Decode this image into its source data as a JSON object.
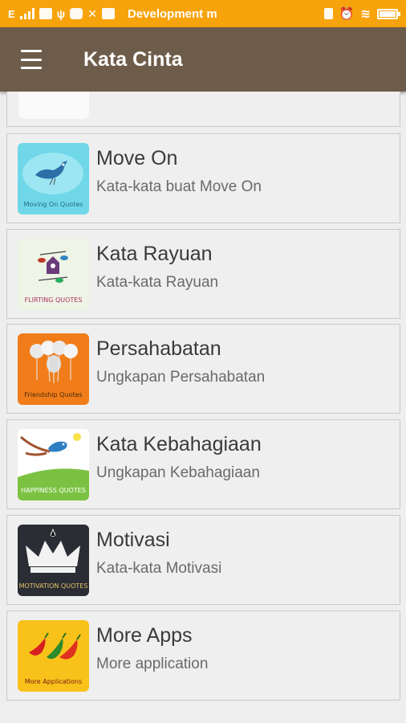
{
  "status_bar": {
    "carrier_text": "Development m",
    "bg_color": "#f7a30b",
    "battery_level": 0.9
  },
  "app_bar": {
    "title": "Kata Cinta",
    "menu_icon": "hamburger-menu-icon",
    "bg_color": "#6e5c4a"
  },
  "items": [
    {
      "title": "Move On",
      "subtitle": "Kata-kata buat Move On",
      "thumb_caption": "Moving On Quotes",
      "thumb_icon": "bird-icon"
    },
    {
      "title": "Kata Rayuan",
      "subtitle": "Kata-kata Rayuan",
      "thumb_caption": "FLIRTING QUOTES",
      "thumb_icon": "birdhouse-icon"
    },
    {
      "title": "Persahabatan",
      "subtitle": "Ungkapan Persahabatan",
      "thumb_caption": "Friendship Quotes",
      "thumb_icon": "balloons-icon"
    },
    {
      "title": "Kata Kebahagiaan",
      "subtitle": "Ungkapan Kebahagiaan",
      "thumb_caption": "HAPPINESS QUOTES",
      "thumb_icon": "bluebird-icon"
    },
    {
      "title": "Motivasi",
      "subtitle": "Kata-kata Motivasi",
      "thumb_caption": "MOTIVATION QUOTES",
      "thumb_icon": "crown-icon"
    },
    {
      "title": "More Apps",
      "subtitle": "More application",
      "thumb_caption": "More Applications",
      "thumb_icon": "chili-peppers-icon"
    }
  ]
}
